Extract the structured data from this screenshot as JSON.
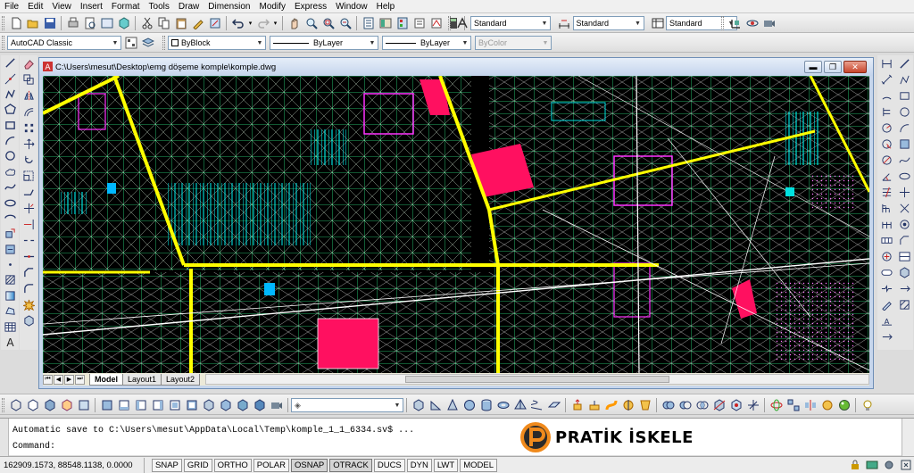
{
  "menubar": {
    "items": [
      "File",
      "Edit",
      "View",
      "Insert",
      "Format",
      "Tools",
      "Draw",
      "Dimension",
      "Modify",
      "Express",
      "Window",
      "Help"
    ]
  },
  "styles_toolbar": {
    "text_style": "Standard",
    "dim_style": "Standard",
    "table_style": "Standard"
  },
  "workspace_toolbar": {
    "workspace": "AutoCAD Classic"
  },
  "properties_toolbar": {
    "color": "ByBlock",
    "linetype": "ByLayer",
    "lineweight": "ByLayer",
    "plotstyle": "ByColor"
  },
  "drawing_window": {
    "title": "C:\\Users\\mesut\\Desktop\\emg döşeme komple\\komple.dwg",
    "tabs": [
      "Model",
      "Layout1",
      "Layout2"
    ],
    "active_tab": "Model"
  },
  "command_line": {
    "history": "Automatic save to C:\\Users\\mesut\\AppData\\Local\\Temp\\komple_1_1_6334.sv$ ...",
    "prompt": "Command:"
  },
  "status_bar": {
    "coordinates": "162909.1573, 88548.1138, 0.0000",
    "toggles": [
      "SNAP",
      "GRID",
      "ORTHO",
      "POLAR",
      "OSNAP",
      "OTRACK",
      "DUCS",
      "DYN",
      "LWT",
      "MODEL"
    ]
  },
  "logo": {
    "text": "PRATİK İSKELE"
  },
  "colors": {
    "canvas_bg": "#000000",
    "main_walls": "#ffff00",
    "grid_lines": "#00ff88",
    "cyan_elements": "#00e0e0",
    "magenta_elements": "#ff33ff",
    "red_fill": "#ff1060",
    "white_lines": "#ffffff"
  }
}
